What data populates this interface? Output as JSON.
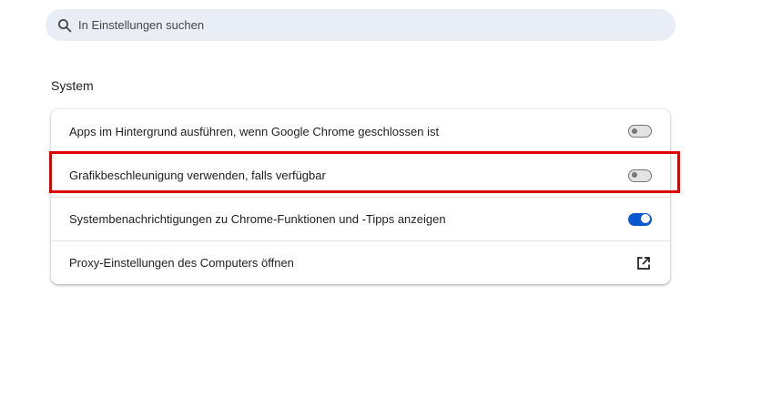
{
  "search": {
    "placeholder": "In Einstellungen suchen",
    "icon": "search-icon"
  },
  "section": {
    "title": "System"
  },
  "settings": [
    {
      "label": "Apps im Hintergrund ausführen, wenn Google Chrome geschlossen ist",
      "control": "toggle",
      "state": "off"
    },
    {
      "label": "Grafikbeschleunigung verwenden, falls verfügbar",
      "control": "toggle",
      "state": "off",
      "highlighted": true
    },
    {
      "label": "Systembenachrichtigungen zu Chrome-Funktionen und -Tipps anzeigen",
      "control": "toggle",
      "state": "on"
    },
    {
      "label": "Proxy-Einstellungen des Computers öffnen",
      "control": "external-link",
      "icon": "open-in-new-icon"
    }
  ],
  "colors": {
    "accent": "#0b57d0",
    "search_background": "#e9eef6",
    "highlight": "#e00000"
  }
}
